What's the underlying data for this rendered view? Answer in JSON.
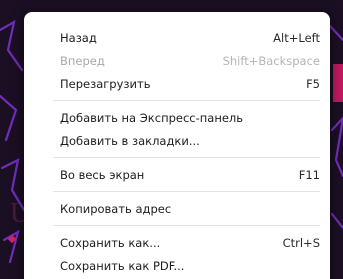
{
  "colors": {
    "background": "#1b0f24",
    "background_accent": "#7a32c8",
    "menu_background": "#ffffff",
    "menu_text": "#1d1d1d",
    "menu_text_disabled": "#a8a8a8",
    "separator": "#e3e3e3"
  },
  "menu": {
    "items": [
      {
        "label": "Назад",
        "shortcut": "Alt+Left"
      },
      {
        "label": "Вперед",
        "shortcut": "Shift+Backspace",
        "disabled": true
      },
      {
        "label": "Перезагрузить",
        "shortcut": "F5"
      },
      {
        "label": "Добавить на Экспресс-панель",
        "shortcut": ""
      },
      {
        "label": "Добавить в закладки...",
        "shortcut": ""
      },
      {
        "label": "Во весь экран",
        "shortcut": "F11"
      },
      {
        "label": "Копировать адрес",
        "shortcut": ""
      },
      {
        "label": "Сохранить как...",
        "shortcut": "Ctrl+S"
      },
      {
        "label": "Сохранить как PDF...",
        "shortcut": ""
      }
    ]
  }
}
